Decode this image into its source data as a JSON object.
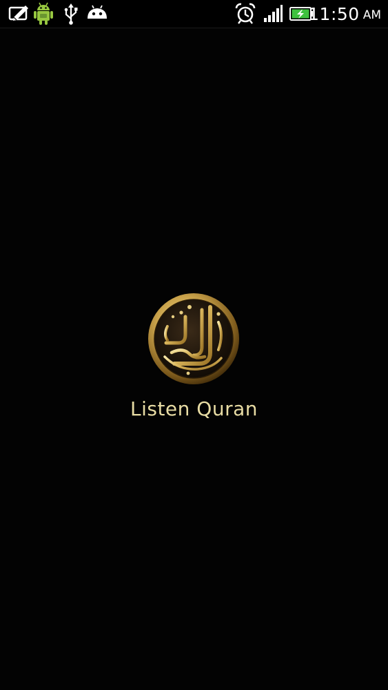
{
  "status_bar": {
    "time": "11:50",
    "ampm": "AM",
    "icons": [
      "pencil-note-icon",
      "android-robot-icon",
      "usb-icon",
      "android-debug-icon",
      "alarm-clock-icon",
      "signal-strength-icon",
      "battery-charging-icon"
    ],
    "battery_color": "#3fc23f",
    "signal_bars": 4
  },
  "splash": {
    "app_name": "Listen Quran",
    "logo_icon": "quran-calligraphy-emblem-icon",
    "logo_lettering": "القرآن الكريم",
    "title_color": "#e8dca4",
    "emblem_gold": "#c9a24a"
  }
}
